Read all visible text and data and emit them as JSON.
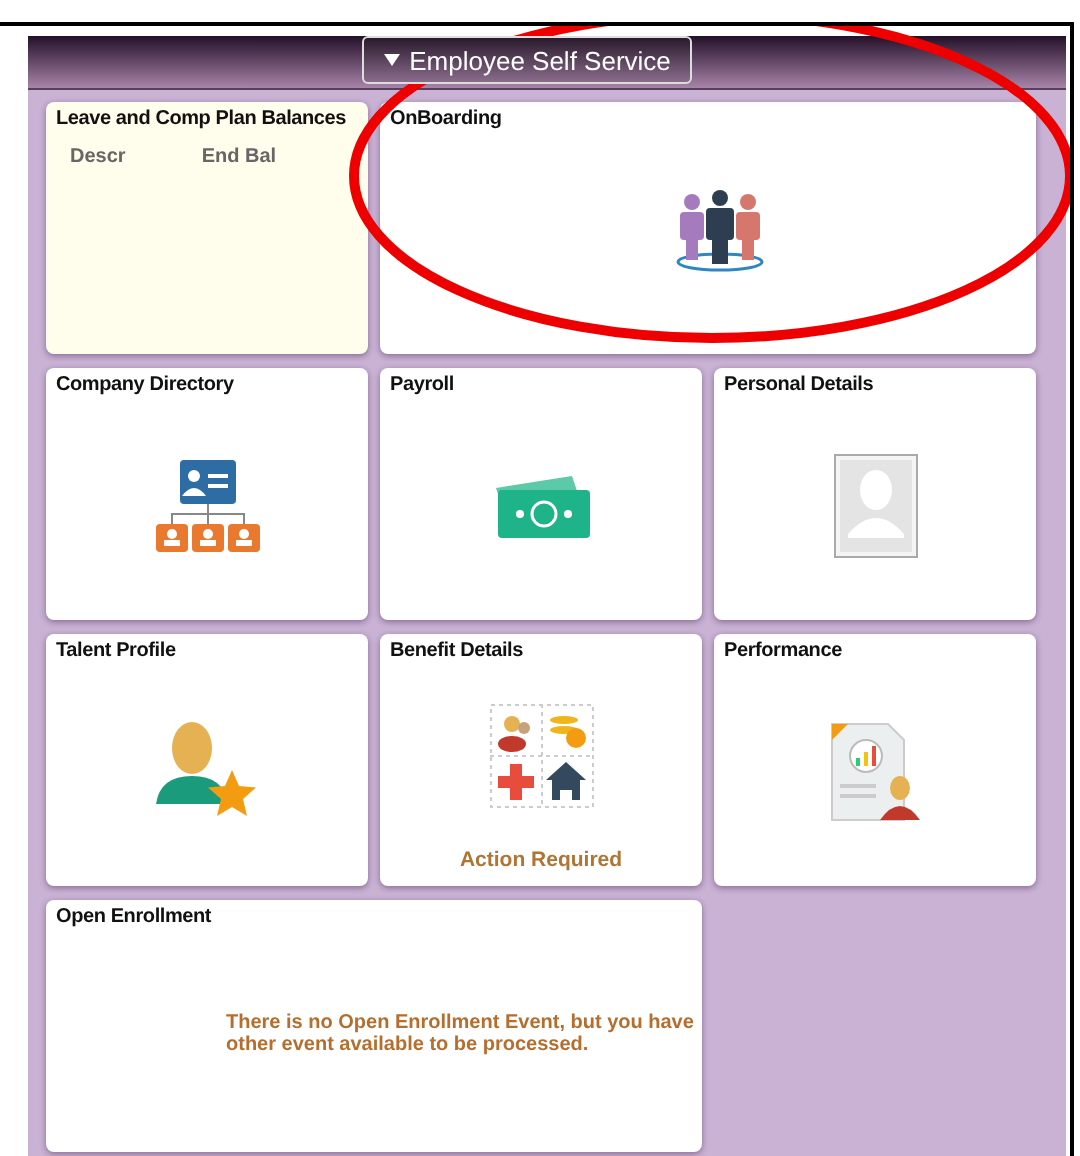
{
  "header": {
    "title": "Employee Self Service"
  },
  "tiles": [
    {
      "kind": "balances",
      "title": "Leave and Comp Plan Balances",
      "columns": [
        "Descr",
        "End Bal"
      ]
    },
    {
      "kind": "icon",
      "title": "OnBoarding"
    },
    {
      "kind": "icon",
      "title": "Company Directory"
    },
    {
      "kind": "icon",
      "title": "Payroll"
    },
    {
      "kind": "icon",
      "title": "Personal Details"
    },
    {
      "kind": "icon",
      "title": "Talent Profile"
    },
    {
      "kind": "status",
      "title": "Benefit Details",
      "status": "Action Required"
    },
    {
      "kind": "icon",
      "title": "Performance"
    },
    {
      "kind": "message",
      "title": "Open Enrollment",
      "message": "There is no Open Enrollment Event, but you have other event available to be processed."
    }
  ]
}
